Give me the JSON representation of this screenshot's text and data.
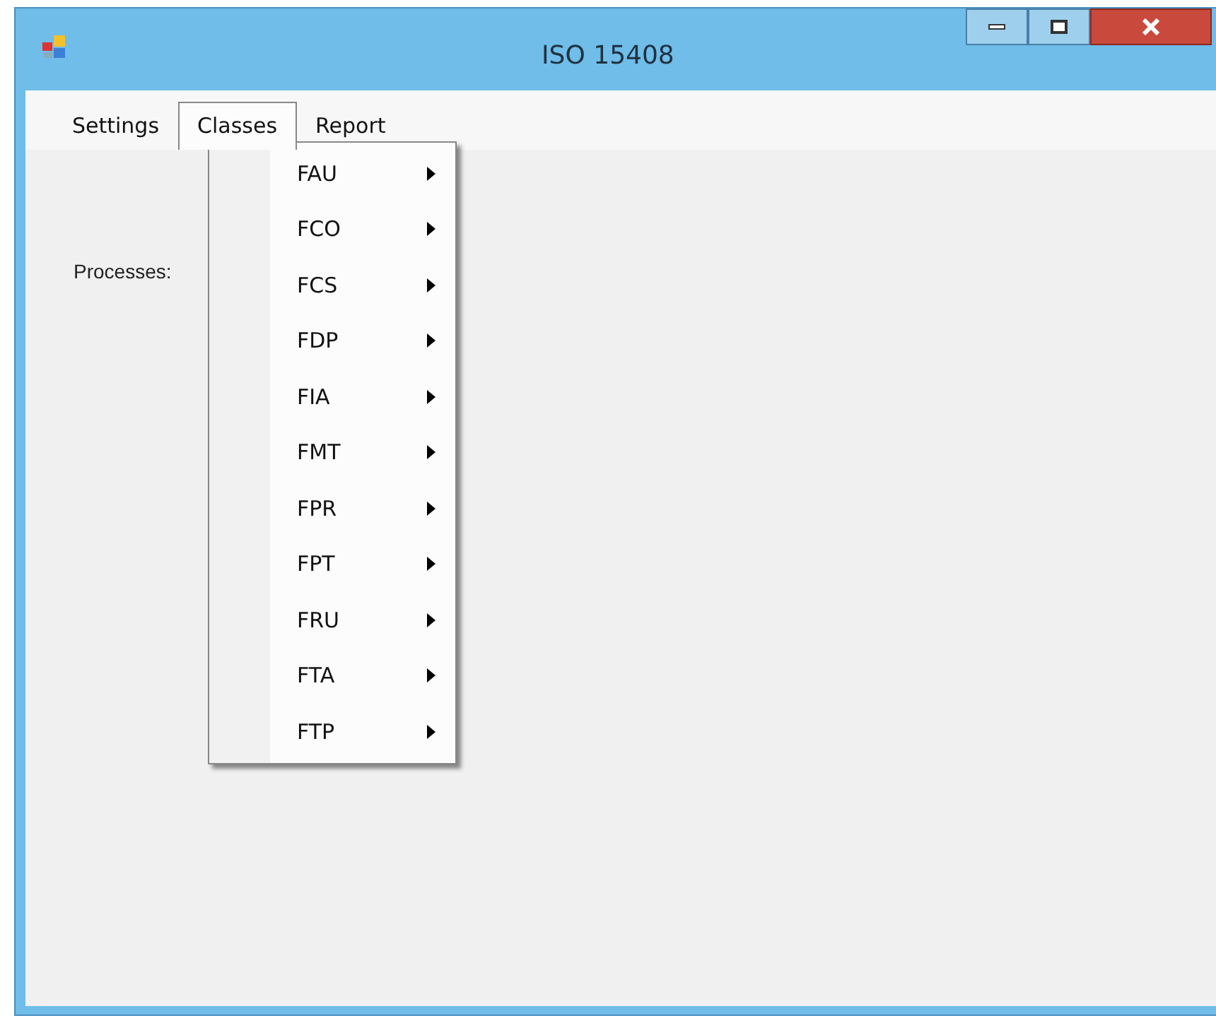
{
  "window": {
    "title": "ISO 15408"
  },
  "menu_bar": [
    {
      "label": "Settings",
      "selected": false
    },
    {
      "label": "Classes",
      "selected": true
    },
    {
      "label": "Report",
      "selected": false
    }
  ],
  "dropdown": [
    {
      "label": "FAU",
      "has_submenu": true
    },
    {
      "label": "FCO",
      "has_submenu": true
    },
    {
      "label": "FCS",
      "has_submenu": true
    },
    {
      "label": "FDP",
      "has_submenu": true
    },
    {
      "label": "FIA",
      "has_submenu": true
    },
    {
      "label": "FMT",
      "has_submenu": true
    },
    {
      "label": "FPR",
      "has_submenu": true
    },
    {
      "label": "FPT",
      "has_submenu": true
    },
    {
      "label": "FRU",
      "has_submenu": true
    },
    {
      "label": "FTA",
      "has_submenu": true
    },
    {
      "label": "FTP",
      "has_submenu": true
    }
  ],
  "processes_label": "Processes:"
}
